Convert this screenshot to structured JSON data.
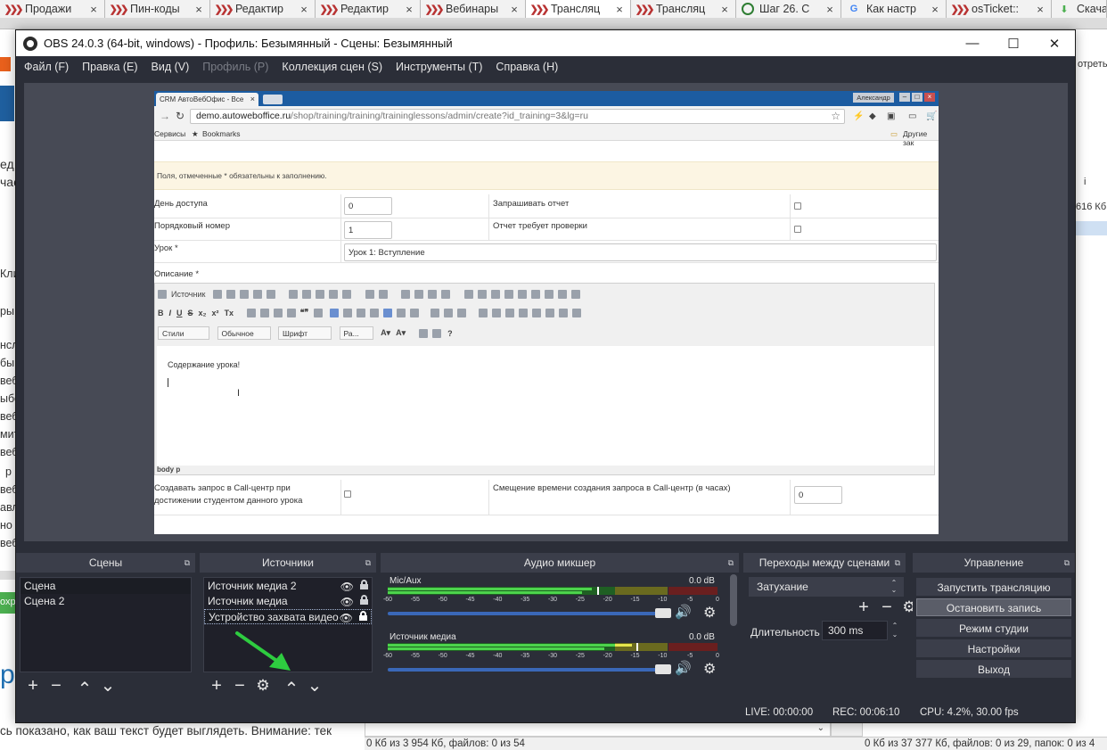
{
  "browser": {
    "tabs": [
      {
        "title": "Продажи",
        "icon": "chevron",
        "active": false
      },
      {
        "title": "Пин-коды",
        "icon": "chevron",
        "active": false
      },
      {
        "title": "Редактир",
        "icon": "chevron",
        "active": false
      },
      {
        "title": "Редактир",
        "icon": "chevron",
        "active": false
      },
      {
        "title": "Вебинары",
        "icon": "chevron",
        "active": false
      },
      {
        "title": "Трансляц",
        "icon": "chevron",
        "active": true
      },
      {
        "title": "Трансляц",
        "icon": "chevron",
        "active": false
      },
      {
        "title": "Шаг 26. С",
        "icon": "shag",
        "active": false
      },
      {
        "title": "Как настр",
        "icon": "google",
        "active": false
      },
      {
        "title": "osTicket::",
        "icon": "chevron",
        "active": false
      },
      {
        "title": "Скачат",
        "icon": "download",
        "active": false
      }
    ],
    "close_glyph": "×"
  },
  "background_page": {
    "left_fragments": [
      "ед",
      "чае",
      "Кли",
      "ры",
      "нсл",
      "бы",
      "веб",
      "ыбе",
      "веб",
      "мит",
      "веб",
      "р",
      "веб",
      "авл",
      "но",
      "веб"
    ],
    "left_green_button": "охр",
    "left_big_letter": "р",
    "right_fragments": [
      "отреть",
      "i",
      "616 Кб"
    ],
    "bottom_text": "сь показано, как ваш текст будет выглядеть. Внимание: тек",
    "status_left": "0 Кб из 3 954 Кб, файлов: 0 из 54",
    "status_right": "0 Кб из 37 377 Кб, файлов: 0 из 29, папок: 0 из 4",
    "select_arrow": "⌄"
  },
  "obs": {
    "title": "OBS 24.0.3 (64-bit, windows) - Профиль: Безымянный - Сцены: Безымянный",
    "window_controls": {
      "minimize": "—",
      "maximize": "☐",
      "close": "✕"
    },
    "menu": [
      {
        "label": "Файл (F)",
        "disabled": false
      },
      {
        "label": "Правка (E)",
        "disabled": false
      },
      {
        "label": "Вид (V)",
        "disabled": false
      },
      {
        "label": "Профиль (P)",
        "disabled": true
      },
      {
        "label": "Коллекция сцен (S)",
        "disabled": false
      },
      {
        "label": "Инструменты (T)",
        "disabled": false
      },
      {
        "label": "Справка (H)",
        "disabled": false
      }
    ],
    "preview": {
      "tab_title": "CRM АвтоВебОфис - Все",
      "user_badge": "Александр",
      "url_host": "demo.autoweboffice.ru",
      "url_path": "/shop/training/training/traininglessons/admin/create?id_training=3&lg=ru",
      "bookmarks": [
        "Сервисы",
        "Bookmarks",
        "Другие зак"
      ],
      "notice": "Поля, отмеченные * обязательны к заполнению.",
      "fields": {
        "access_day_label": "День доступа",
        "access_day_value": "0",
        "request_report_label": "Запрашивать отчет",
        "order_label": "Порядковый номер",
        "order_value": "1",
        "report_check_label": "Отчет требует проверки",
        "lesson_label": "Урок *",
        "lesson_value": "Урок 1: Вступление",
        "description_label": "Описание *",
        "callcenter_label_1": "Создавать запрос в Call-центр при",
        "callcenter_label_2": "достижении студентом данного урока",
        "offset_label": "Смещение времени создания запроса в Call-центр (в часах)",
        "offset_value": "0"
      },
      "editor": {
        "source_button": "Источник",
        "combos": [
          "Стили",
          "Обычное",
          "Шрифт",
          "Ра..."
        ],
        "content": "Содержание урока!",
        "path": "body  p"
      }
    },
    "docks": {
      "scenes": {
        "title": "Сцены",
        "items": [
          "Сцена",
          "Сцена 2"
        ]
      },
      "sources": {
        "title": "Источники",
        "items": [
          {
            "name": "Источник медиа 2",
            "locked": false
          },
          {
            "name": "Источник медиа",
            "locked": false
          },
          {
            "name": "Устройство захвата видео",
            "locked": true
          }
        ]
      },
      "mixer": {
        "title": "Аудио микшер",
        "channels": [
          {
            "name": "Mic/Aux",
            "db": "0.0 dB",
            "level": 0.62,
            "volume": 1.0
          },
          {
            "name": "Источник медиа",
            "db": "0.0 dB",
            "level": 0.74,
            "volume": 1.0
          }
        ],
        "ticks": [
          "-60",
          "-55",
          "-50",
          "-45",
          "-40",
          "-35",
          "-30",
          "-25",
          "-20",
          "-15",
          "-10",
          "-5",
          "0"
        ]
      },
      "transitions": {
        "title": "Переходы между сценами",
        "selected": "Затухание",
        "duration_label": "Длительность",
        "duration_value": "300 ms"
      },
      "controls": {
        "title": "Управление",
        "buttons": [
          "Запустить трансляцию",
          "Остановить запись",
          "Режим студии",
          "Настройки",
          "Выход"
        ]
      }
    },
    "status": {
      "live": "LIVE: 00:00:00",
      "rec": "REC: 00:06:10",
      "cpu": "CPU: 4.2%, 30.00 fps"
    },
    "glyphs": {
      "add": "+",
      "remove": "−",
      "up": "⌃",
      "down": "⌄",
      "gear": "⚙",
      "eye": "👁",
      "speaker": "🔊",
      "float": "⧉"
    },
    "colors": {
      "bg": "#2b2e38",
      "panel_header": "#3b3e4a",
      "list_bg": "#1f2029",
      "annotation_arrow": "#2ecc40"
    }
  }
}
